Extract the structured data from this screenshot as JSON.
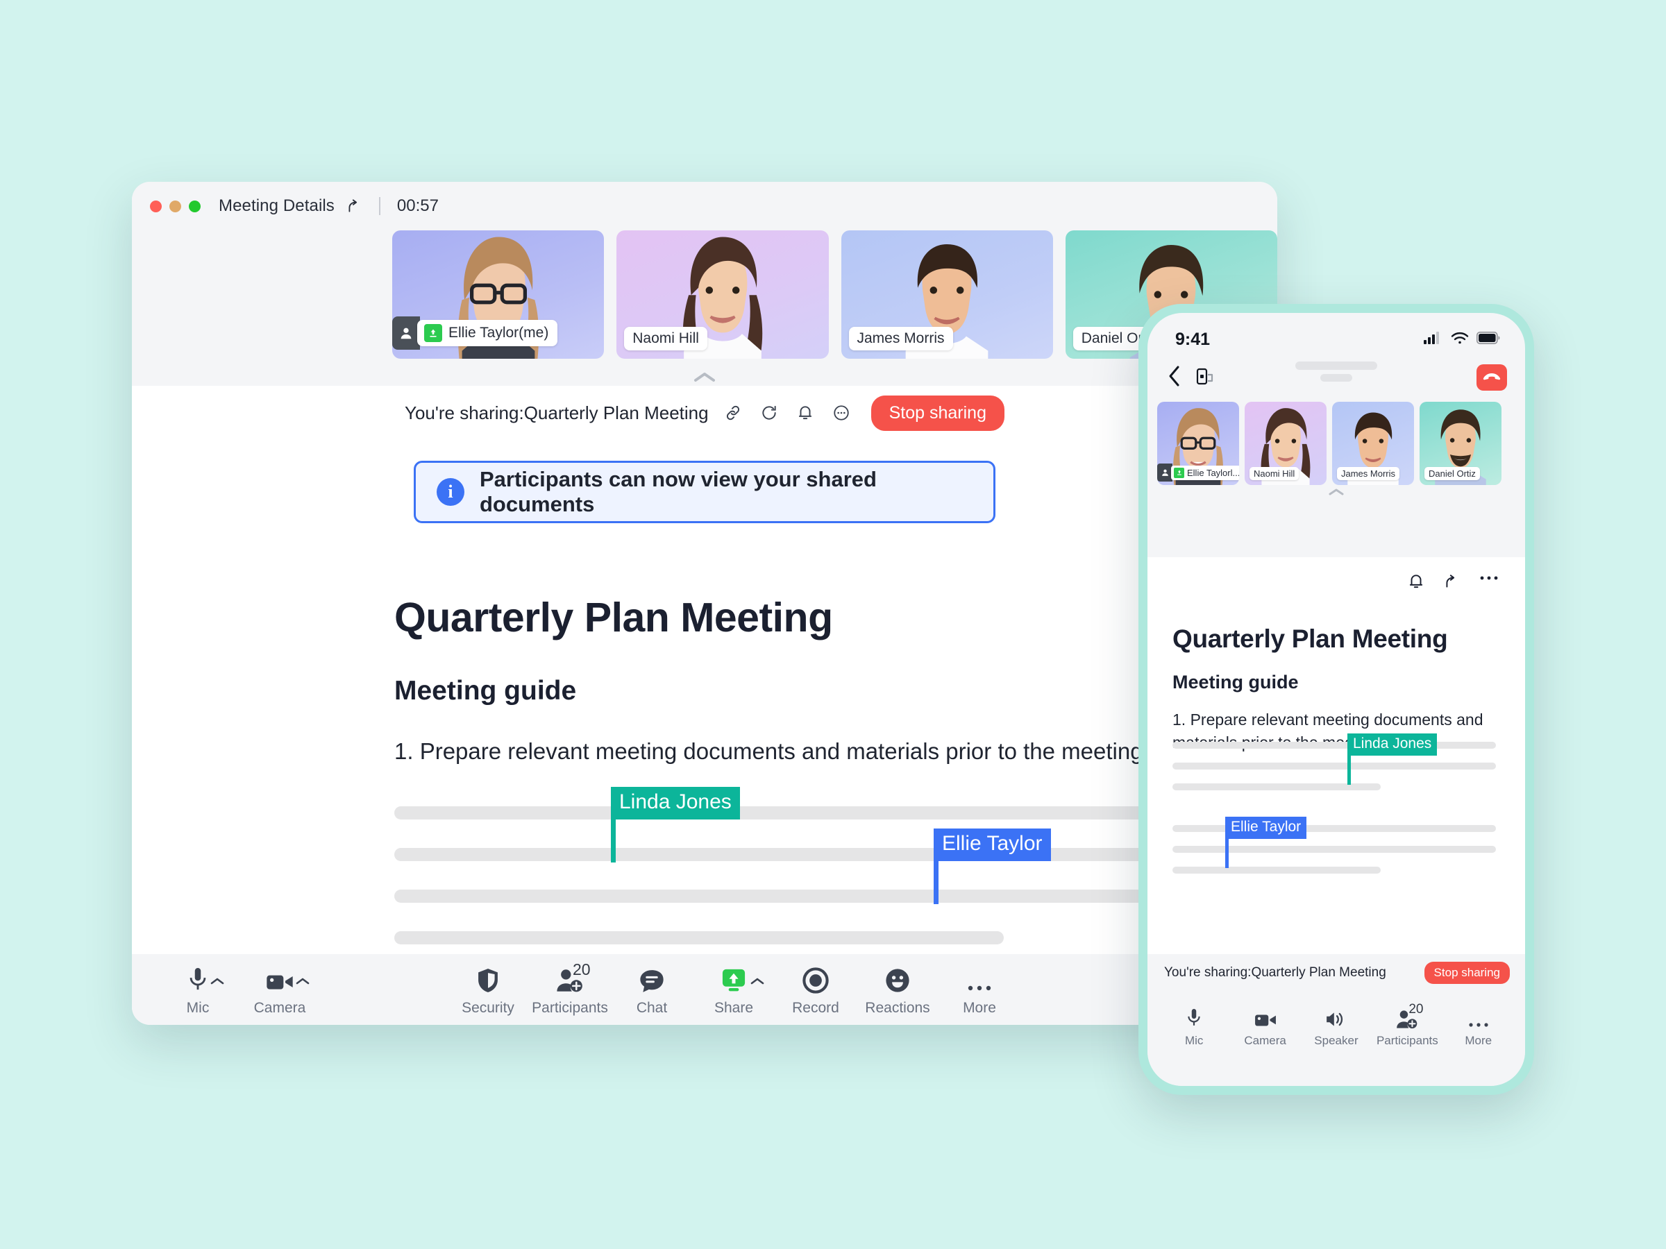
{
  "desktop": {
    "titlebar": {
      "title": "Meeting Details",
      "share_icon": "share-icon",
      "timer": "00:57"
    },
    "participants": [
      {
        "name": "Ellie Taylor(me)",
        "is_me": true
      },
      {
        "name": "Naomi Hill",
        "is_me": false
      },
      {
        "name": "James Morris",
        "is_me": false
      },
      {
        "name": "Daniel Ortiz",
        "is_me": false
      }
    ],
    "sharebar": {
      "text": "You're sharing:Quarterly Plan Meeting",
      "icons": [
        "link-icon",
        "refresh-icon",
        "bell-icon",
        "more-icon"
      ],
      "stop_label": "Stop sharing"
    },
    "banner": {
      "icon": "info-icon",
      "text": "Participants can now view your shared documents"
    },
    "document": {
      "title": "Quarterly Plan Meeting",
      "subtitle": "Meeting guide",
      "paragraph": "1. Prepare relevant meeting documents and materials prior to the meeting."
    },
    "cursors": [
      {
        "name": "Linda Jones",
        "color": "#0cb59a"
      },
      {
        "name": "Ellie Taylor",
        "color": "#3b72f5"
      }
    ],
    "toolbar": [
      {
        "label": "Mic",
        "icon": "mic-icon",
        "has_caret": true
      },
      {
        "label": "Camera",
        "icon": "camera-icon",
        "has_caret": true
      },
      {
        "label": "Security",
        "icon": "shield-icon",
        "has_caret": false
      },
      {
        "label": "Participants",
        "icon": "participants-icon",
        "badge": "20",
        "has_caret": false
      },
      {
        "label": "Chat",
        "icon": "chat-icon",
        "has_caret": false
      },
      {
        "label": "Share",
        "icon": "share-screen-icon",
        "has_caret": true
      },
      {
        "label": "Record",
        "icon": "record-icon",
        "has_caret": false
      },
      {
        "label": "Reactions",
        "icon": "reactions-icon",
        "has_caret": false
      },
      {
        "label": "More",
        "icon": "more-icon",
        "has_caret": false
      }
    ]
  },
  "phone": {
    "statusbar": {
      "time": "9:41",
      "signal": "signal-icon",
      "wifi": "wifi-icon",
      "battery": "battery-icon"
    },
    "nav": {
      "back": "back-icon",
      "cast": "cast-icon",
      "end_call": "end-call-icon"
    },
    "participants": [
      {
        "name": "Ellie Taylorl...",
        "is_me": true
      },
      {
        "name": "Naomi Hill",
        "is_me": false
      },
      {
        "name": "James Morris",
        "is_me": false
      },
      {
        "name": "Daniel Ortiz",
        "is_me": false
      }
    ],
    "actions": [
      "bell-icon",
      "share-icon",
      "more-icon"
    ],
    "document": {
      "title": "Quarterly Plan Meeting",
      "subtitle": "Meeting guide",
      "paragraph": "1. Prepare relevant meeting documents and materials prior to the meeting."
    },
    "cursors": [
      {
        "name": "Linda Jones",
        "color": "#0cb59a"
      },
      {
        "name": "Ellie Taylor",
        "color": "#3b72f5"
      }
    ],
    "sharebar": {
      "text": "You're sharing:Quarterly Plan Meeting",
      "stop_label": "Stop sharing"
    },
    "toolbar": [
      {
        "label": "Mic",
        "icon": "mic-icon"
      },
      {
        "label": "Camera",
        "icon": "camera-icon"
      },
      {
        "label": "Speaker",
        "icon": "speaker-icon"
      },
      {
        "label": "Participants",
        "icon": "participants-icon",
        "badge": "20"
      },
      {
        "label": "More",
        "icon": "more-icon"
      }
    ]
  },
  "colors": {
    "accent_red": "#f5524a",
    "accent_blue": "#3b72f5",
    "accent_green": "#0cb59a",
    "share_green": "#2ccb4f",
    "page_bg": "#d2f3ee"
  }
}
